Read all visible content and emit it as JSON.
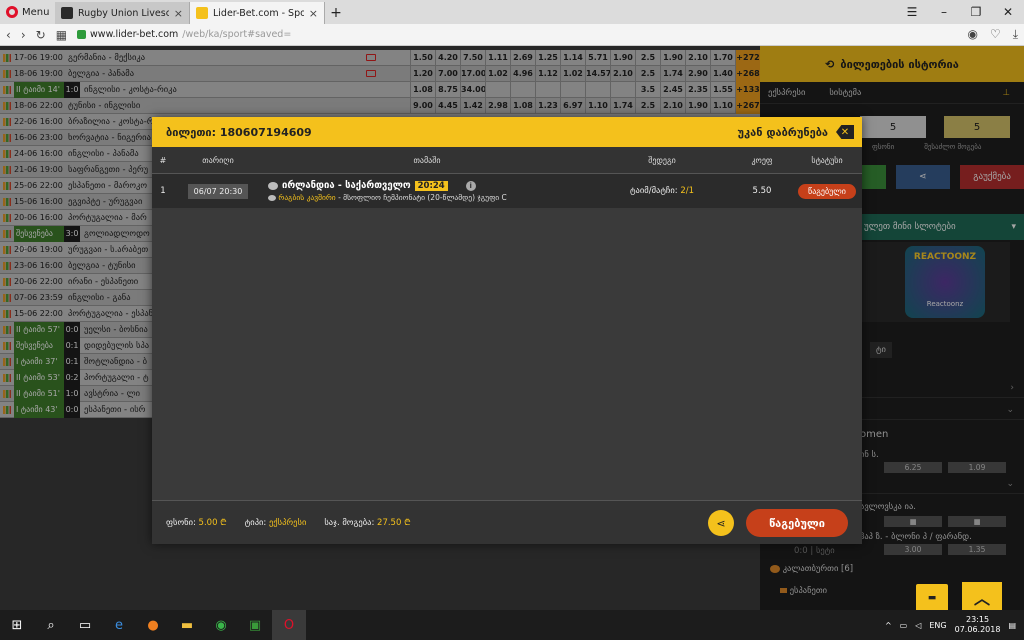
{
  "browser": {
    "menu_label": "Menu",
    "tabs": [
      {
        "title": "Rugby Union Livescore - L",
        "fav": "#2a2a2a"
      },
      {
        "title": "Lider-Bet.com - Sports and",
        "fav": "#f4c11c"
      }
    ],
    "url_host": "www.lider-bet.com",
    "url_path": "/web/ka/sport#saved="
  },
  "grid_rows": [
    {
      "time": "17-06 19:00",
      "live": false,
      "score": "",
      "name": "გერმანია - მექსიკა",
      "tv": true,
      "odds": [
        "1.50",
        "4.20",
        "7.50",
        "1.11",
        "2.69",
        "1.25",
        "1.14",
        "5.71",
        "1.90",
        "2.5",
        "1.90",
        "2.10",
        "1.70"
      ],
      "plus": "+272"
    },
    {
      "time": "18-06 19:00",
      "live": false,
      "score": "",
      "name": "ბელგია - პანამა",
      "tv": true,
      "odds": [
        "1.20",
        "7.00",
        "17.00",
        "1.02",
        "4.96",
        "1.12",
        "1.02",
        "14.57",
        "2.10",
        "2.5",
        "1.74",
        "2.90",
        "1.40"
      ],
      "plus": "+268"
    },
    {
      "time": "II ტაიმი 14'",
      "live": true,
      "score": "1:0",
      "name": "ინგლისი - კოსტა-რიკა",
      "tv": false,
      "odds": [
        "1.08",
        "8.75",
        "34.00",
        "",
        "",
        "",
        "",
        "",
        "",
        "3.5",
        "2.45",
        "2.35",
        "1.55"
      ],
      "plus": "+133"
    },
    {
      "time": "18-06 22:00",
      "live": false,
      "score": "",
      "name": "ტუნისი - ინგლისი",
      "tv": false,
      "odds": [
        "9.00",
        "4.45",
        "1.42",
        "2.98",
        "1.08",
        "1.23",
        "6.97",
        "1.10",
        "1.74",
        "2.5",
        "2.10",
        "1.90",
        "1.10"
      ],
      "plus": "+267"
    },
    {
      "time": "22-06 16:00",
      "live": false,
      "score": "",
      "name": "ბრაზილია - კოსტა-რ",
      "tv": false,
      "odds": [],
      "plus": ""
    },
    {
      "time": "16-06 23:00",
      "live": false,
      "score": "",
      "name": "ხორვატია - ნიგერია",
      "tv": false,
      "odds": [],
      "plus": ""
    },
    {
      "time": "24-06 16:00",
      "live": false,
      "score": "",
      "name": "ინგლისი - პანამა",
      "tv": false,
      "odds": [],
      "plus": ""
    },
    {
      "time": "21-06 19:00",
      "live": false,
      "score": "",
      "name": "საფრანგეთი - პერუ",
      "tv": false,
      "odds": [],
      "plus": ""
    },
    {
      "time": "25-06 22:00",
      "live": false,
      "score": "",
      "name": "ესპანეთი - მაროკო",
      "tv": false,
      "odds": [],
      "plus": ""
    },
    {
      "time": "15-06 16:00",
      "live": false,
      "score": "",
      "name": "ეგვიპტე - ურუგვაი",
      "tv": false,
      "odds": [],
      "plus": ""
    },
    {
      "time": "20-06 16:00",
      "live": false,
      "score": "",
      "name": "პორტუგალია - მარ",
      "tv": false,
      "odds": [],
      "plus": ""
    },
    {
      "time": "შესვენება 45'",
      "live": true,
      "score": "3:0",
      "name": "გოლიადლოდო",
      "tv": false,
      "odds": [],
      "plus": ""
    },
    {
      "time": "20-06 19:00",
      "live": false,
      "score": "",
      "name": "ურუგვაი - ს.არაბეთ",
      "tv": false,
      "odds": [],
      "plus": ""
    },
    {
      "time": "23-06 16:00",
      "live": false,
      "score": "",
      "name": "ბელგია - ტუნისი",
      "tv": false,
      "odds": [],
      "plus": ""
    },
    {
      "time": "20-06 22:00",
      "live": false,
      "score": "",
      "name": "ირანი - ესპანეთი",
      "tv": false,
      "odds": [],
      "plus": ""
    },
    {
      "time": "07-06 23:59",
      "live": false,
      "score": "",
      "name": "ინგლისი - განა",
      "tv": false,
      "odds": [],
      "plus": ""
    },
    {
      "time": "15-06 22:00",
      "live": false,
      "score": "",
      "name": "პორტუგალია - ესპან",
      "tv": false,
      "odds": [],
      "plus": ""
    },
    {
      "time": "II ტაიმი 57'",
      "live": true,
      "score": "0:0",
      "name": "უელსი - ბოსნია",
      "tv": false,
      "odds": [],
      "plus": ""
    },
    {
      "time": "შესვენება 45'",
      "live": true,
      "score": "0:1",
      "name": "დიდებულის სპა",
      "tv": false,
      "odds": [],
      "plus": ""
    },
    {
      "time": "I ტაიმი 37'",
      "live": true,
      "score": "0:1",
      "name": "შოტლანდია - ბ",
      "tv": false,
      "odds": [],
      "plus": ""
    },
    {
      "time": "II ტაიმი 53'",
      "live": true,
      "score": "0:2",
      "name": "პორტუგალი - ტ",
      "tv": false,
      "odds": [],
      "plus": ""
    },
    {
      "time": "II ტაიმი 51'",
      "live": true,
      "score": "1:0",
      "name": "ავსტრია - ლი",
      "tv": false,
      "odds": [],
      "plus": ""
    },
    {
      "time": "I ტაიმი 43'",
      "live": true,
      "score": "0:0",
      "name": "ესპანეთი - ისრ",
      "tv": false,
      "odds": [],
      "plus": ""
    }
  ],
  "right": {
    "header": "ბილეთების ისტორია",
    "tab1": "ექსპრესი",
    "tab2": "სისტემა",
    "box1": "5",
    "box2": "5",
    "lbl1": "ფსონი",
    "lbl2": "შესაძლო მოგება",
    "btn_share_icon": "share-icon",
    "btn3": "გაუქმება",
    "slots": "ულეთ მინი სლოტები",
    "game": "REACTOONZ",
    "game_sub": "Reactoonz",
    "misc1": "ტი",
    "misc2": "omen",
    "misc3": "ინ ს.",
    "odd1": "6.25",
    "odd2": "1.09",
    "misc4": "ავლოვსკა ია.",
    "misc5": "ჰაპ ზ. - ბლონი პ / ფარანდ.",
    "odd3": "3.00",
    "odd4": "1.35",
    "misc6": "0:0 | სეტი",
    "cat": "კალათბურთი [6]",
    "cat2": "ესპანეთი"
  },
  "modal": {
    "title": "ბილეთი: 180607194609",
    "back": "უკან დაბრუნება",
    "cols": [
      "#",
      "თარიღი",
      "თამაში",
      "შედეგი",
      "კოეფ",
      "სტატუსი"
    ],
    "row": {
      "num": "1",
      "date": "06/07 20:30",
      "event": "ირლანდია - საქართველო",
      "time": "20:24",
      "category": "რაგბის კავშირი",
      "league": "- მსოფლიო ჩემპიონატი (20-წლამდე) ჯგუფი C",
      "result_label": "ტაიმ/მატჩი:",
      "result_value": "2/1",
      "odd": "5.50",
      "status": "წაგებული"
    },
    "stake_label": "ფსონი:",
    "stake": "5.00 ₾",
    "type_label": "ტიპი:",
    "type": "ექსპრესი",
    "win_label": "საჯ. მოგება:",
    "win": "27.50 ₾",
    "final": "წაგებული"
  },
  "taskbar": {
    "lang": "ENG",
    "time": "23:15",
    "date": "07.06.2018"
  }
}
